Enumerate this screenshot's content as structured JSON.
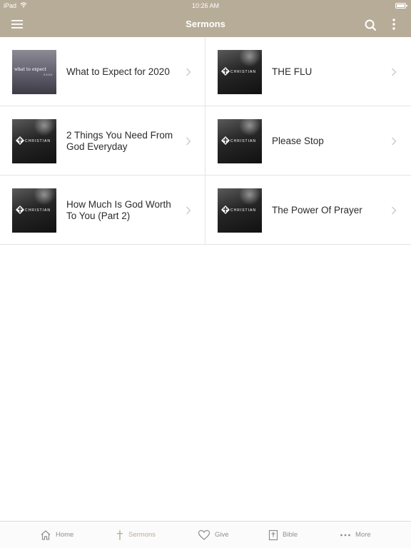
{
  "status_bar": {
    "carrier": "iPad",
    "time": "10:26 AM"
  },
  "nav": {
    "title": "Sermons",
    "menu_icon": "hamburger-menu-icon",
    "search_icon": "search-icon",
    "more_icon": "more-vertical-icon"
  },
  "colors": {
    "brand": "#b7ac98",
    "divider": "#e4e4e4",
    "tab_inactive": "#8f8f8f"
  },
  "sermons": [
    {
      "title": "What to Expect for 2020",
      "thumb_text": "what to expect",
      "thumb_sub": "2020"
    },
    {
      "title": "THE FLU",
      "thumb_text": "CHRISTIAN"
    },
    {
      "title": "2 Things You Need From God Everyday",
      "thumb_text": "CHRISTIAN"
    },
    {
      "title": "Please Stop",
      "thumb_text": "CHRISTIAN"
    },
    {
      "title": "How Much Is God Worth To You (Part 2)",
      "thumb_text": "CHRISTIAN"
    },
    {
      "title": "The Power Of Prayer",
      "thumb_text": "CHRISTIAN"
    }
  ],
  "tabs": [
    {
      "label": "Home",
      "icon": "home-icon",
      "active": false
    },
    {
      "label": "Sermons",
      "icon": "cross-icon",
      "active": true
    },
    {
      "label": "Give",
      "icon": "heart-icon",
      "active": false
    },
    {
      "label": "Bible",
      "icon": "bible-icon",
      "active": false
    },
    {
      "label": "More",
      "icon": "more-dots-icon",
      "active": false
    }
  ]
}
